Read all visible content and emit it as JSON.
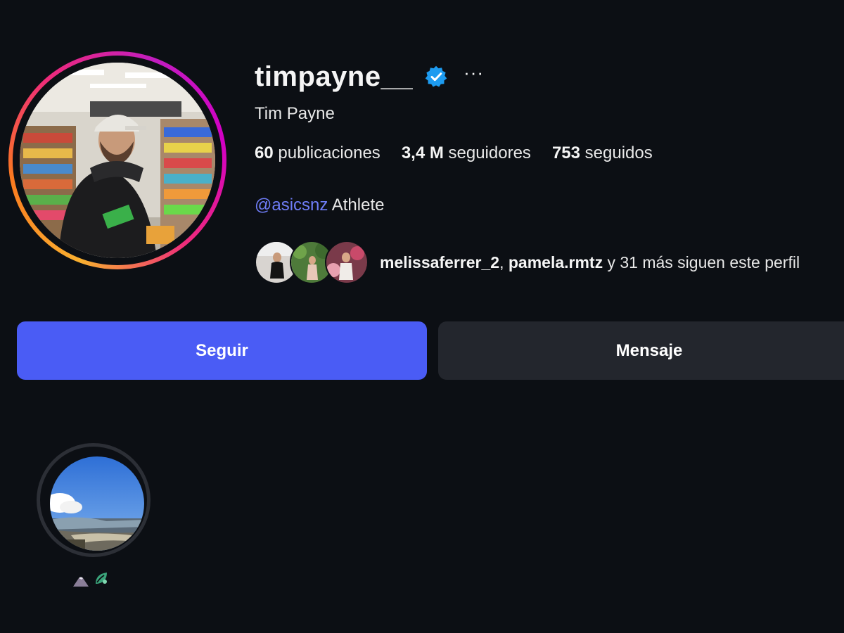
{
  "profile": {
    "username": "timpayne__",
    "verified": true,
    "more_label": "···",
    "full_name": "Tim Payne",
    "stats": {
      "posts_count": "60",
      "posts_label": "publicaciones",
      "followers_count": "3,4 M",
      "followers_label": "seguidores",
      "following_count": "753",
      "following_label": "seguidos"
    },
    "bio": {
      "mention": "@asicsnz",
      "text": "Athlete"
    },
    "followed_by": {
      "user1": "melissaferrer_2",
      "separator": ", ",
      "user2": "pamela.rmtz",
      "rest": "y 31 más siguen este perfil"
    }
  },
  "actions": {
    "follow_label": "Seguir",
    "message_label": "Mensaje"
  },
  "highlights": [
    {
      "icon_names": [
        "mountain-icon",
        "leaf-icon"
      ]
    }
  ],
  "colors": {
    "background": "#0c0f14",
    "follow_button": "#4a5cf5",
    "message_button": "#23262d",
    "mention": "#6f7df7",
    "verified_badge": "#1d9bf0"
  }
}
